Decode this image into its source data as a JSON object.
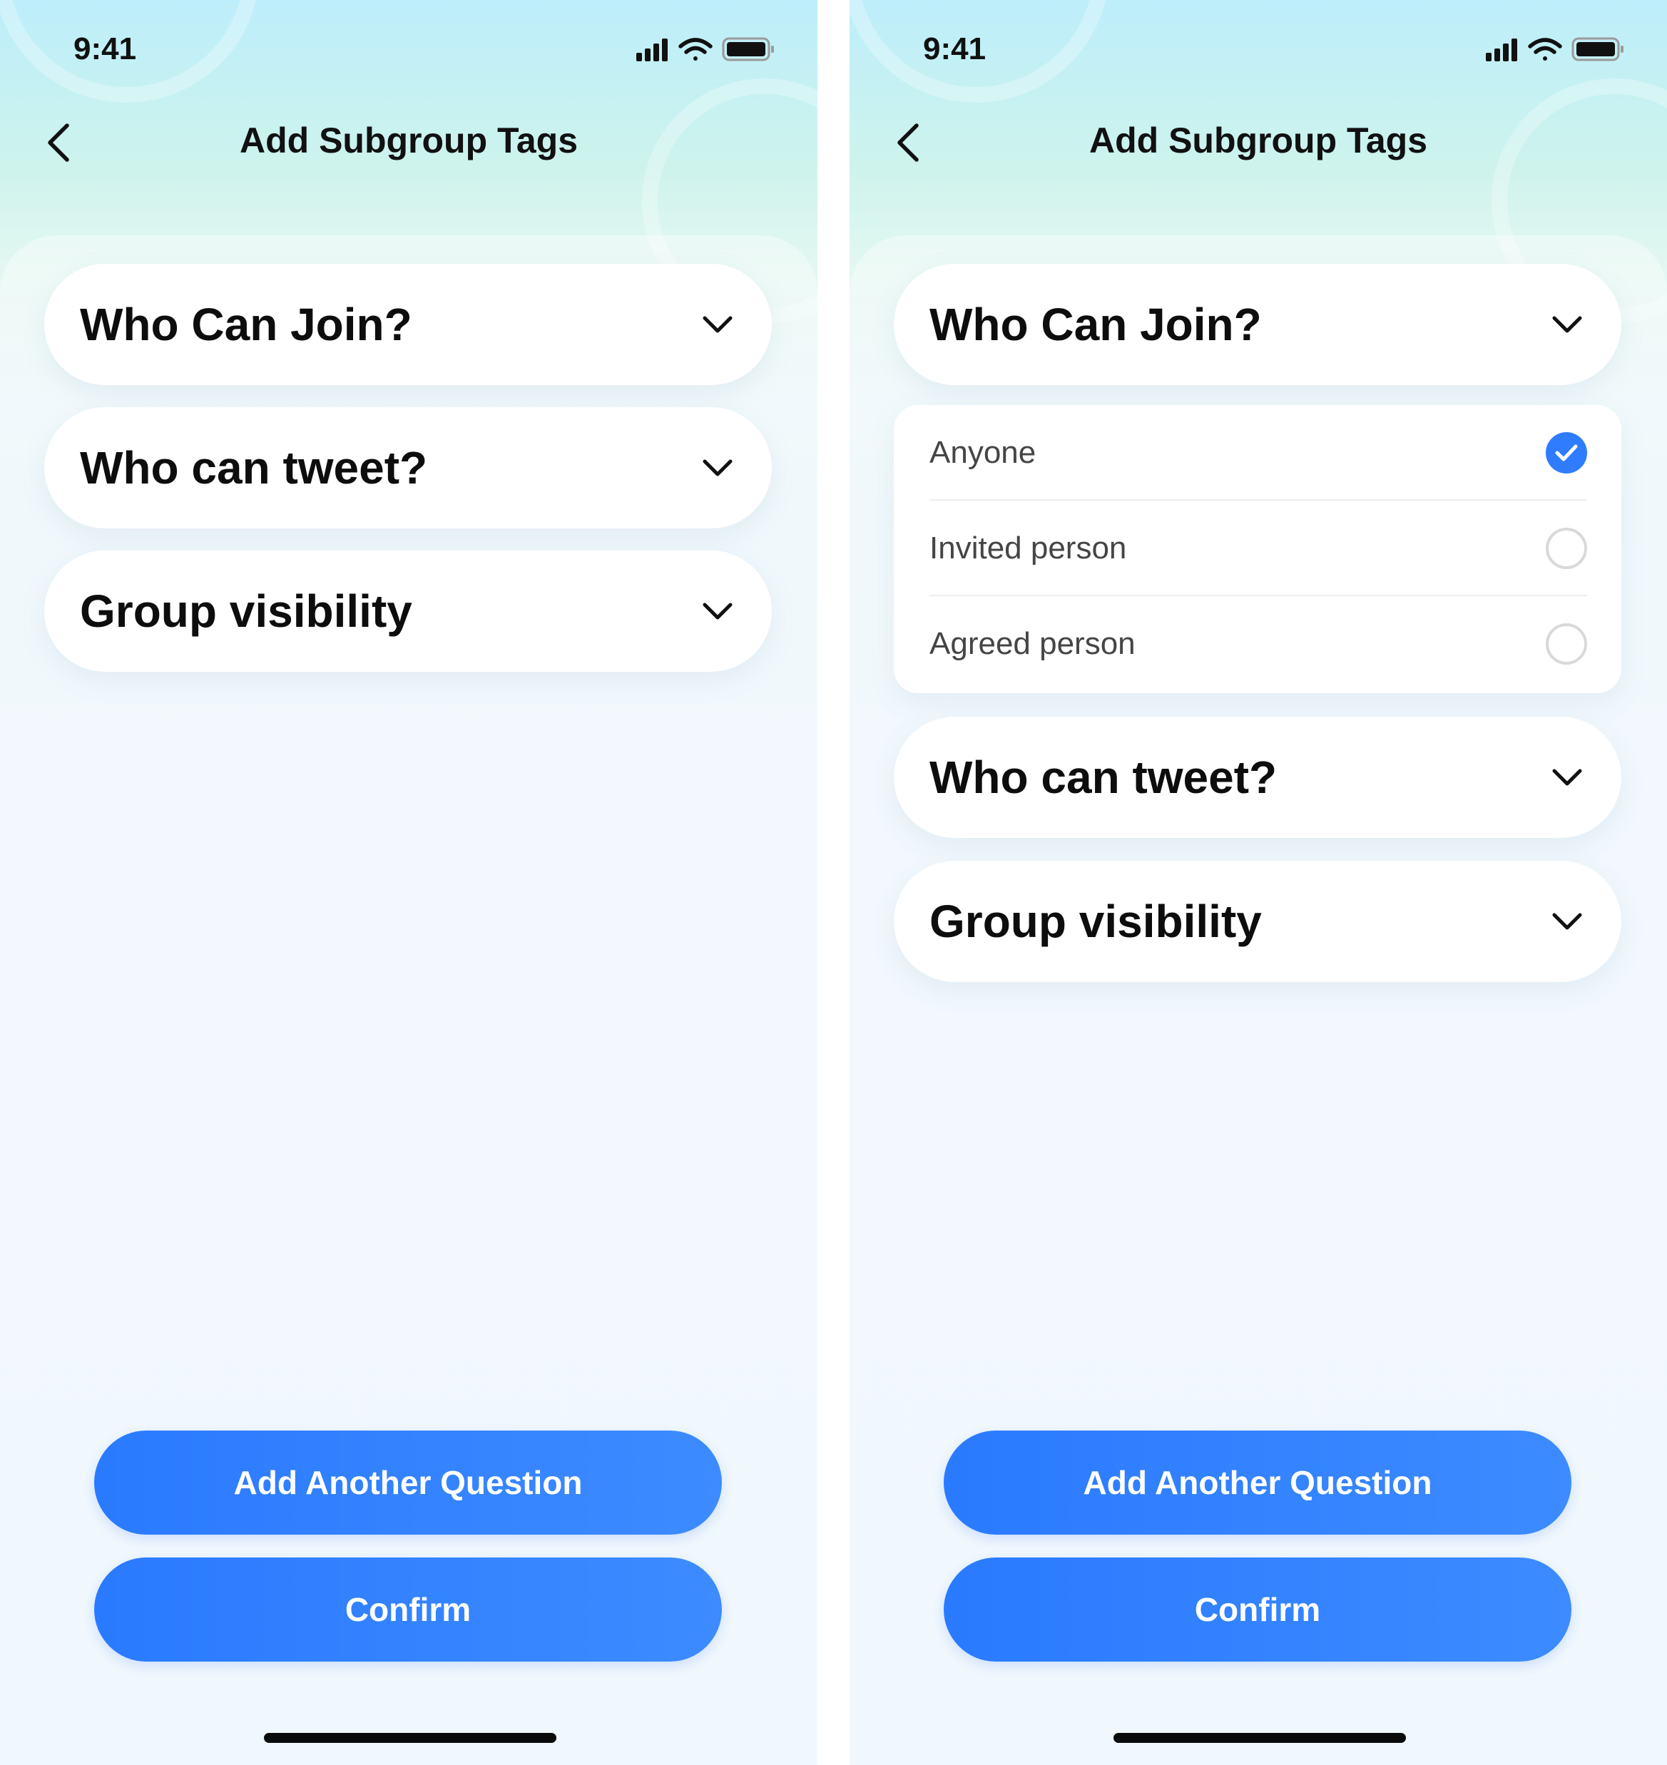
{
  "screens": {
    "collapsed": {
      "status": {
        "time": "9:41"
      },
      "nav": {
        "title": "Add Subgroup Tags"
      },
      "sections": [
        {
          "label": "Who Can Join?"
        },
        {
          "label": "Who can tweet?"
        },
        {
          "label": "Group visibility"
        }
      ],
      "buttons": {
        "add_question": "Add Another Question",
        "confirm": "Confirm"
      }
    },
    "expanded": {
      "status": {
        "time": "9:41"
      },
      "nav": {
        "title": "Add Subgroup Tags"
      },
      "sections": [
        {
          "label": "Who Can Join?",
          "expanded": true,
          "options": [
            {
              "label": "Anyone",
              "selected": true
            },
            {
              "label": "Invited person",
              "selected": false
            },
            {
              "label": "Agreed person",
              "selected": false
            }
          ]
        },
        {
          "label": "Who can tweet?"
        },
        {
          "label": "Group visibility"
        }
      ],
      "buttons": {
        "add_question": "Add Another Question",
        "confirm": "Confirm"
      }
    }
  },
  "icons": {
    "back": "chevron-left-icon",
    "expand": "chevron-down-icon",
    "signal": "cellular-signal-icon",
    "wifi": "wifi-icon",
    "battery": "battery-icon",
    "selected": "check-circle-icon"
  },
  "colors": {
    "accent": "#2f7cff",
    "button_gradient_start": "#2a7aff",
    "button_gradient_end": "#3d8bff",
    "background_top": "#bdeefb",
    "background_bottom": "#f1f8fd",
    "card": "#ffffff",
    "text_primary": "#0d0d0d",
    "text_secondary": "#454545"
  }
}
